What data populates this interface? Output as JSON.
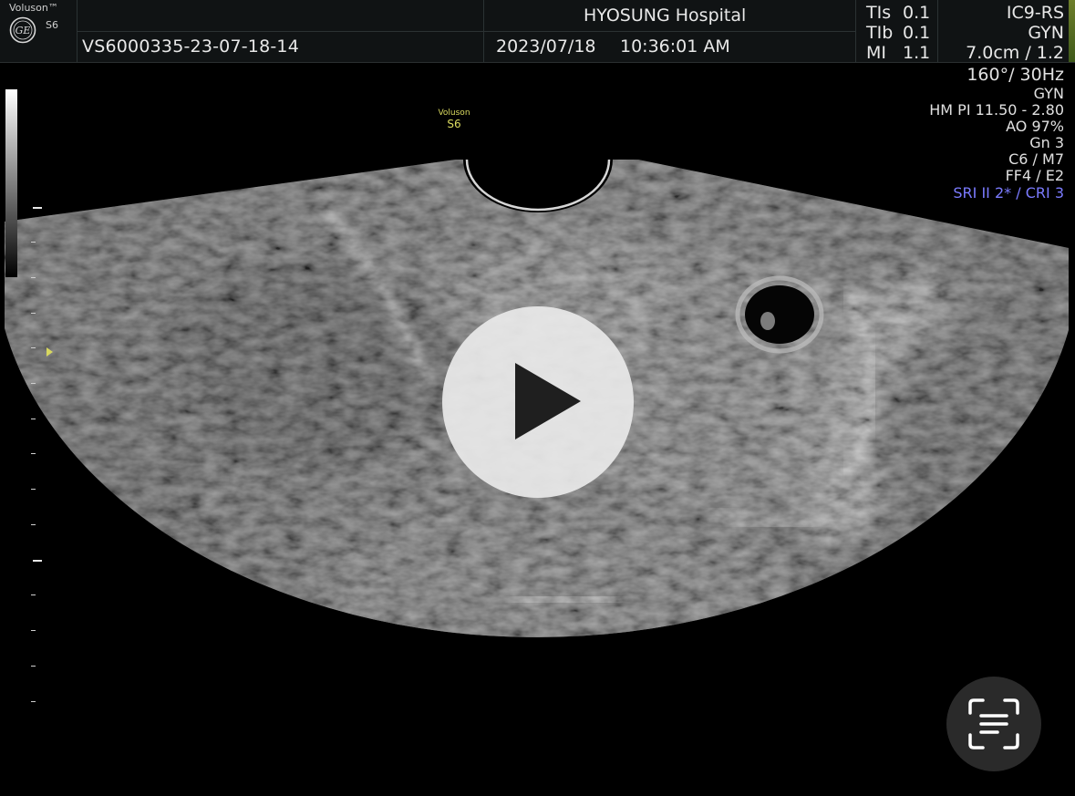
{
  "header": {
    "brand": "Voluson™",
    "model_small": "S6",
    "patient_id": "VS6000335-23-07-18-14",
    "hospital": "HYOSUNG Hospital",
    "date": "2023/07/18",
    "time": "10:36:01 AM",
    "indices": [
      {
        "label": "TIs",
        "value": "0.1"
      },
      {
        "label": "TIb",
        "value": "0.1"
      },
      {
        "label": "MI",
        "value": "1.1"
      }
    ],
    "probe": "IC9-RS",
    "preset": "GYN",
    "depth_freq": "7.0cm / 1.2"
  },
  "params": {
    "angle_rate": "160°/ 30Hz",
    "mode": "GYN",
    "harmonic": "HM PI 11.50 - 2.80",
    "acoustic_output": "AO 97%",
    "gain": "Gn  3",
    "contrast_map": "C6 / M7",
    "filter_enhance": "FF4 / E2",
    "sri_cri": "SRI II 2* / CRI 3"
  },
  "image_logo": {
    "name": "Voluson",
    "model": "S6"
  },
  "overlay": {
    "play_icon": "play-icon",
    "scan_icon": "scan-text-icon"
  },
  "colors": {
    "header_bg": "#101314",
    "marker_yellow": "#dcdc60",
    "sri_blue": "#7b7bff",
    "status_green": "#6d7e2a"
  }
}
